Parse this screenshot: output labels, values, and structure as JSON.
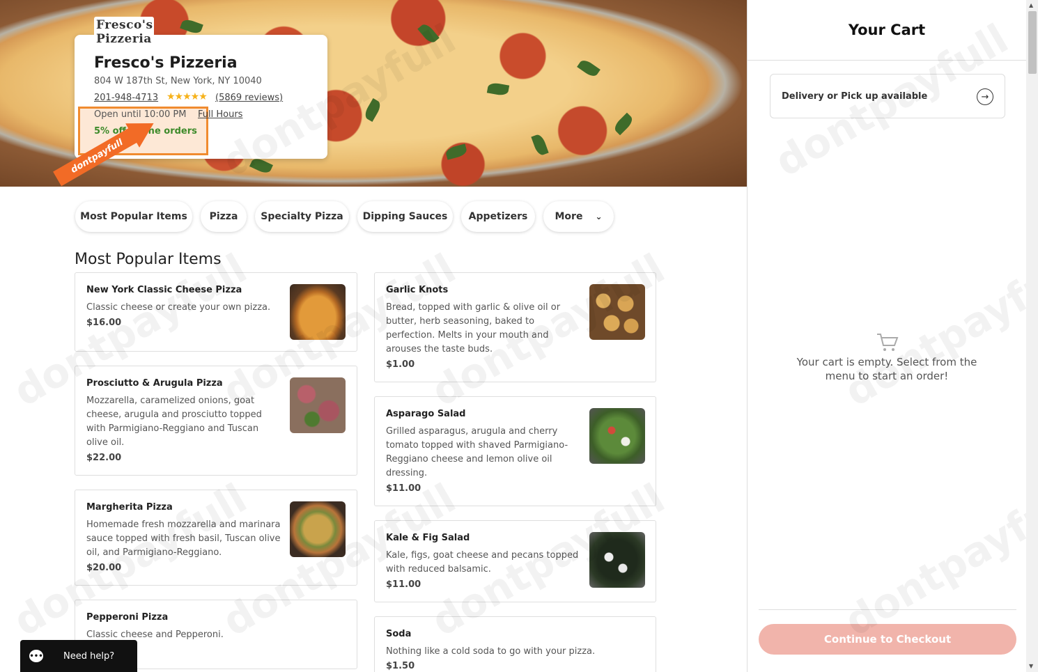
{
  "restaurant": {
    "logo_line1": "Fresco's",
    "logo_line2": "Pizzeria",
    "name": "Fresco's Pizzeria",
    "address": "804 W 187th St, New York, NY 10040",
    "phone": "201-948-4713",
    "rating_stars": "★★★★★",
    "reviews": "(5869 reviews)",
    "open_until": "Open until 10:00 PM",
    "full_hours": "Full Hours",
    "promo": "5% off online orders"
  },
  "badge": {
    "text": "dontpayfull"
  },
  "tabs": [
    {
      "label": "Most Popular Items"
    },
    {
      "label": "Pizza"
    },
    {
      "label": "Specialty Pizza"
    },
    {
      "label": "Dipping Sauces"
    },
    {
      "label": "Appetizers"
    },
    {
      "label": "More"
    }
  ],
  "section_title": "Most Popular Items",
  "menu_items": [
    {
      "name": "New York Classic Cheese Pizza",
      "description": "Classic cheese or create your own pizza.",
      "price": "$16.00"
    },
    {
      "name": "Prosciutto & Arugula Pizza",
      "description": "Mozzarella, caramelized onions, goat cheese, arugula and prosciutto topped with Parmigiano-Reggiano and Tuscan olive oil.",
      "price": "$22.00"
    },
    {
      "name": "Margherita Pizza",
      "description": "Homemade fresh mozzarella and marinara sauce topped with fresh basil, Tuscan olive oil, and Parmigiano-Reggiano.",
      "price": "$20.00"
    },
    {
      "name": "Pepperoni Pizza",
      "description": "Classic cheese and Pepperoni.",
      "price": ""
    },
    {
      "name": "Garlic Knots",
      "description": "Bread, topped with garlic & olive oil or butter, herb seasoning, baked to perfection. Melts in your mouth and arouses the taste buds.",
      "price": "$1.00"
    },
    {
      "name": "Asparago Salad",
      "description": "Grilled asparagus, arugula and cherry tomato topped with shaved Parmigiano-Reggiano cheese and lemon olive oil dressing.",
      "price": "$11.00"
    },
    {
      "name": "Kale & Fig Salad",
      "description": "Kale, figs, goat cheese and pecans topped with reduced balsamic.",
      "price": "$11.00"
    },
    {
      "name": "Soda",
      "description": "Nothing like a cold soda to go with your pizza.",
      "price": "$1.50"
    }
  ],
  "help": {
    "label": "Need help?"
  },
  "cart": {
    "title": "Your Cart",
    "delivery_label": "Delivery or Pick up available",
    "empty_message": "Your cart is empty. Select from the menu to start an order!",
    "checkout_label": "Continue to Checkout"
  },
  "watermark": "dontpayfull",
  "colors": {
    "promo_green": "#3d8a2a",
    "highlight_orange": "#f08b2f",
    "checkout_pink": "#f1b4ab",
    "star_gold": "#f6b21b"
  }
}
